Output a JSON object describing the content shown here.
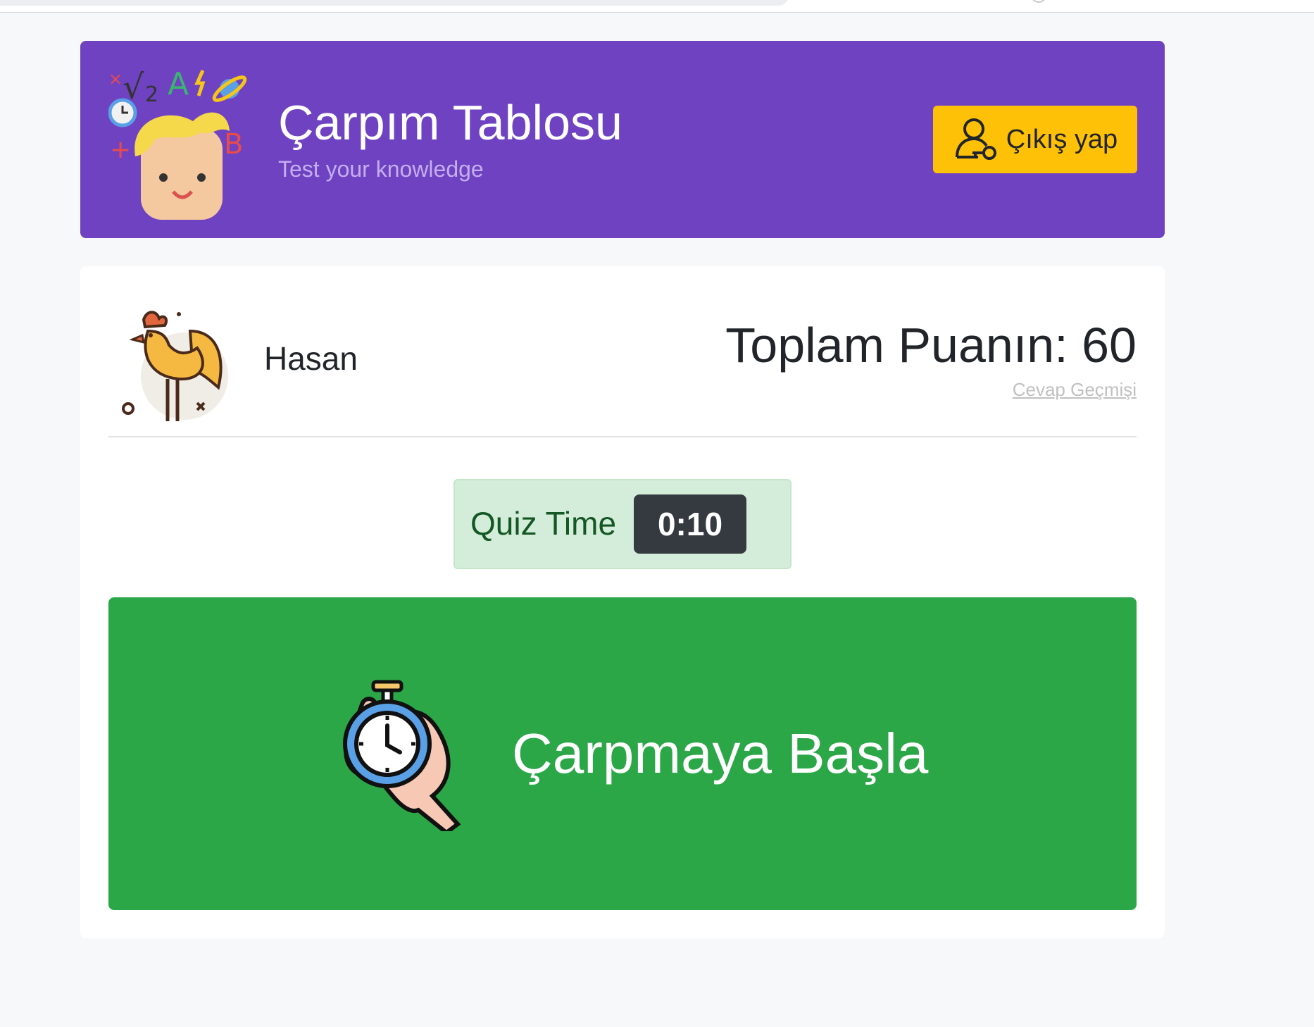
{
  "header": {
    "title": "Çarpım Tablosu",
    "subtitle": "Test your knowledge",
    "logout_label": "Çıkış yap"
  },
  "profile": {
    "name": "Hasan",
    "score_text": "Toplam Puanın: 60",
    "history_link": "Cevap Geçmişi"
  },
  "quiz": {
    "label": "Quiz Time",
    "time": "0:10"
  },
  "start": {
    "label": "Çarpmaya Başla"
  },
  "logo_glyphs": {
    "root": "√",
    "two": "2",
    "a": "A",
    "b": "B",
    "plus": "+",
    "times": "×"
  },
  "icons": {
    "logo": "kid-math-logo-icon",
    "logout": "user-key-icon",
    "avatar": "rooster-avatar-icon",
    "start": "stopwatch-hand-icon"
  },
  "colors": {
    "header_bg": "#6f42c1",
    "logout_bg": "#ffc107",
    "quiz_bg": "#d4edda",
    "timer_bg": "#343a40",
    "start_bg": "#2ba748",
    "page_bg": "#f7f8fa"
  }
}
